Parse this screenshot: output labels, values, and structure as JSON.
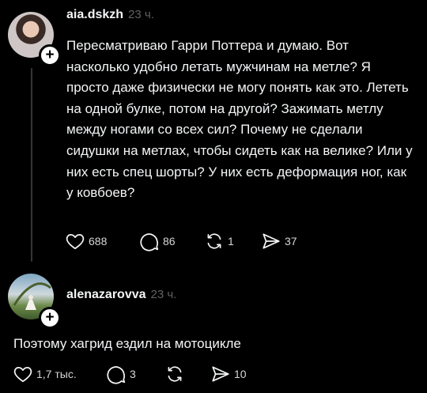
{
  "posts": [
    {
      "username": "aia.dskzh",
      "time": "23 ч.",
      "text": "Пересматриваю Гарри Поттера и думаю. Вот насколько удобно летать мужчинам на метле? Я просто даже физически не могу понять как это. Лететь на одной булке, потом на другой? Зажимать метлу между ногами со всех сил? Почему не сделали сидушки на метлах, чтобы сидеть как на велике? Или у них есть спец шорты? У них есть деформация ног, как у ковбоев?",
      "likes": "688",
      "comments": "86",
      "reposts": "1",
      "shares": "37"
    },
    {
      "username": "alenazarovva",
      "time": "23 ч.",
      "text": "Поэтому хагрид ездил на мотоцикле",
      "likes": "1,7 тыс.",
      "comments": "3",
      "reposts": "",
      "shares": "10"
    }
  ],
  "icons": {
    "like": "heart-icon",
    "comment": "comment-bubble-icon",
    "repost": "repost-arrows-icon",
    "share": "send-plane-icon",
    "follow": "plus-icon"
  },
  "colors": {
    "background": "#000000",
    "text": "#f3f5f7",
    "muted": "#616161",
    "thread_line": "#333638"
  }
}
